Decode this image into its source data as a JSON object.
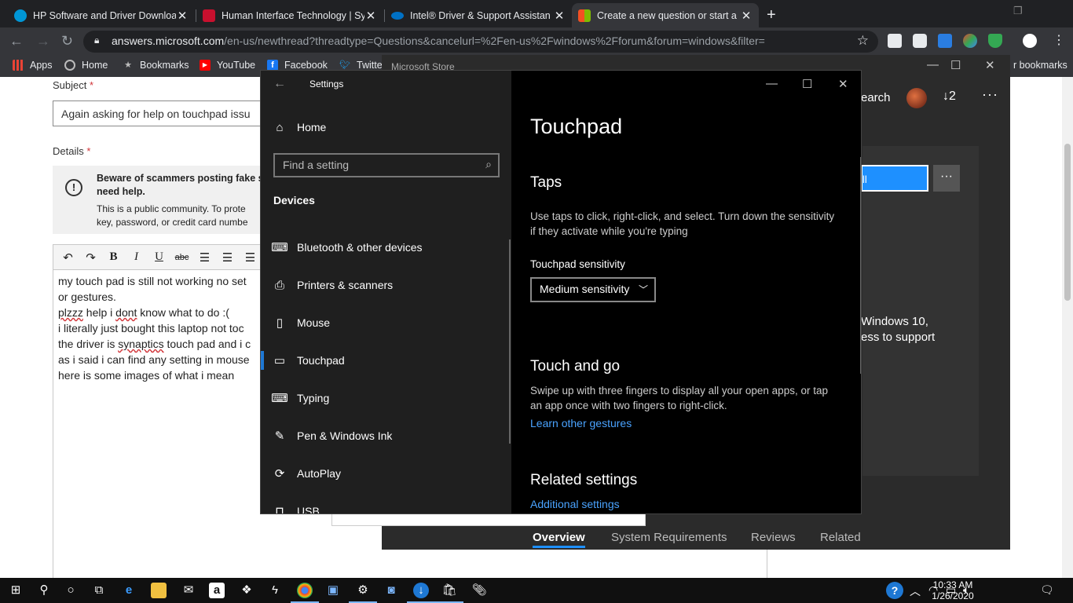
{
  "browser": {
    "tabs": [
      {
        "title": "HP Software and Driver Downloa",
        "favicon_color": "#0096d6"
      },
      {
        "title": "Human Interface Technology | Sy",
        "favicon_color": "#c8102e"
      },
      {
        "title": "Intel® Driver & Support Assistan",
        "favicon_color": "#0071c5"
      },
      {
        "title": "Create a new question or start a",
        "favicon_color": "#f25022"
      }
    ],
    "url_host": "answers.microsoft.com",
    "url_path": "/en-us/newthread?threadtype=Questions&cancelurl=%2Fen-us%2Fwindows%2Fforum&forum=windows&filter=",
    "bookmarks": [
      {
        "label": "Apps",
        "icon": "apps-grid-icon"
      },
      {
        "label": "Home",
        "icon": "globe-icon"
      },
      {
        "label": "Bookmarks",
        "icon": "star-icon"
      },
      {
        "label": "YouTube",
        "icon": "youtube-icon"
      },
      {
        "label": "Facebook",
        "icon": "facebook-icon"
      },
      {
        "label": "Twitte",
        "icon": "twitter-icon"
      }
    ],
    "other_bookmarks": "r bookmarks"
  },
  "page": {
    "subject_label": "Subject",
    "subject_value": "Again asking for help on touchpad issu",
    "details_label": "Details",
    "required_mark": "*",
    "warning_title": "Beware of scammers posting fake s you need help.",
    "warning_line1": "This is a public community. To prote",
    "warning_line2": "key, password, or credit card numbe",
    "editor_lines": [
      "my touch pad is still not working no set",
      "or gestures.",
      "plzzz help i dont know what to do :(",
      "i literally just bought this laptop not toc",
      "the driver is synaptics touch pad and i c",
      "as i said i can find any setting in mouse",
      "here is some images of what i mean"
    ]
  },
  "store": {
    "title": "Microsoft Store",
    "search_fragment": "earch",
    "downloads_count": "2",
    "install_fragment": "ll",
    "desc_line1": "Windows 10,",
    "desc_line2": "ess to support",
    "tabs": [
      "Overview",
      "System Requirements",
      "Reviews",
      "Related"
    ]
  },
  "settings": {
    "window_title": "Settings",
    "home": "Home",
    "search_placeholder": "Find a setting",
    "section": "Devices",
    "nav_items": [
      {
        "label": "Bluetooth & other devices",
        "icon": "bluetooth-keyboard-icon"
      },
      {
        "label": "Printers & scanners",
        "icon": "printer-icon"
      },
      {
        "label": "Mouse",
        "icon": "mouse-icon"
      },
      {
        "label": "Touchpad",
        "icon": "touchpad-icon"
      },
      {
        "label": "Typing",
        "icon": "keyboard-icon"
      },
      {
        "label": "Pen & Windows Ink",
        "icon": "pen-icon"
      },
      {
        "label": "AutoPlay",
        "icon": "autoplay-icon"
      },
      {
        "label": "USB",
        "icon": "usb-icon"
      }
    ],
    "selected": "Touchpad",
    "page_title": "Touchpad",
    "taps_heading": "Taps",
    "taps_desc": "Use taps to click, right-click, and select. Turn down the sensitivity if they activate while you're typing",
    "sensitivity_label": "Touchpad sensitivity",
    "sensitivity_value": "Medium sensitivity",
    "touch_heading": "Touch and go",
    "touch_desc": "Swipe up with three fingers to display all your open apps, or tap an app once with two fingers to right-click.",
    "gestures_link": "Learn other gestures",
    "related_heading": "Related settings",
    "additional_link": "Additional settings"
  },
  "taskbar": {
    "time": "10:33 AM",
    "date": "1/26/2020"
  },
  "colors": {
    "accent": "#1e78d4",
    "link": "#4aa3ff",
    "chrome_dark": "#202124"
  }
}
